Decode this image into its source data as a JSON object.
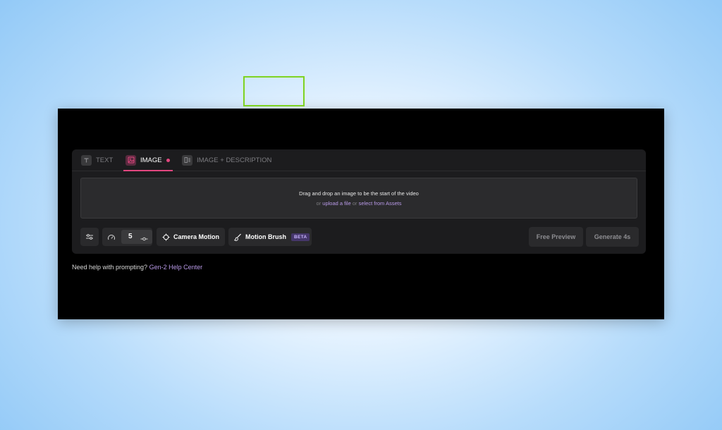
{
  "tabs": [
    {
      "label": "TEXT",
      "icon": "text-icon"
    },
    {
      "label": "IMAGE",
      "icon": "image-icon"
    },
    {
      "label": "IMAGE + DESCRIPTION",
      "icon": "image-description-icon"
    }
  ],
  "dropzone": {
    "line1": "Drag and drop an image to be the start of the video",
    "or1": "or",
    "upload": "upload a file",
    "or2": "or",
    "assets": "select from Assets"
  },
  "toolbar": {
    "motion_value": "5",
    "camera_motion": "Camera Motion",
    "motion_brush": "Motion Brush",
    "beta": "BETA",
    "free_preview": "Free Preview",
    "generate": "Generate 4s"
  },
  "help": {
    "text": "Need help with prompting?",
    "link": "Gen-2 Help Center"
  },
  "colors": {
    "accent": "#e2477f",
    "link": "#b99ae8",
    "highlight": "#7ed321"
  }
}
